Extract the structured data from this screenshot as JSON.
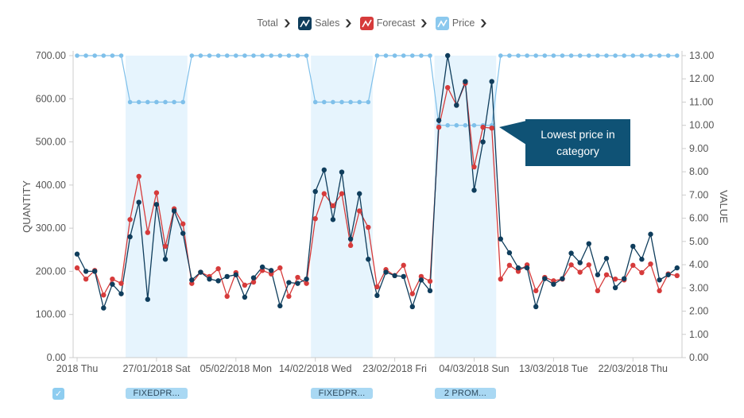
{
  "legend": {
    "items": [
      {
        "label": "Total",
        "has_icon": false
      },
      {
        "label": "Sales",
        "icon": "line-chart-icon",
        "color": "#0f3d5c"
      },
      {
        "label": "Forecast",
        "icon": "line-chart-icon",
        "color": "#d63b3b"
      },
      {
        "label": "Price",
        "icon": "line-chart-icon",
        "color": "#8cc9ee"
      }
    ],
    "dropdown_icon": "chevron-down-icon"
  },
  "callout": {
    "text_line1": "Lowest price in",
    "text_line2": "category"
  },
  "promotions": {
    "checkbox_checked": true,
    "tags": [
      {
        "label": "FIXEDPR...",
        "start_index": 6,
        "end_index": 12
      },
      {
        "label": "FIXEDPR...",
        "start_index": 27,
        "end_index": 33
      },
      {
        "label": "2 PROM...",
        "start_index": 41,
        "end_index": 47
      }
    ]
  },
  "colors": {
    "sales": "#0f3d5c",
    "forecast": "#d63b3b",
    "price": "#7fc0ea",
    "promo_band": "#e6f4fd",
    "axis": "#cccccc"
  },
  "chart_data": {
    "type": "line",
    "title": "",
    "xlabel": "",
    "ylabel": "QUANTITY",
    "y2label": "VALUE",
    "ylim": [
      0,
      700
    ],
    "y2lim": [
      0,
      13
    ],
    "yticks": [
      "0.00",
      "100.00",
      "200.00",
      "300.00",
      "400.00",
      "500.00",
      "600.00",
      "700.00"
    ],
    "y2ticks": [
      "0.00",
      "1.00",
      "2.00",
      "3.00",
      "4.00",
      "5.00",
      "6.00",
      "7.00",
      "8.00",
      "9.00",
      "10.00",
      "11.00",
      "12.00",
      "13.00"
    ],
    "x_start": "18/01/2018",
    "x_step_days": 1,
    "xticks": [
      {
        "index": 0,
        "label": "2018 Thu"
      },
      {
        "index": 9,
        "label": "27/01/2018 Sat"
      },
      {
        "index": 18,
        "label": "05/02/2018 Mon"
      },
      {
        "index": 27,
        "label": "14/02/2018 Wed"
      },
      {
        "index": 36,
        "label": "23/02/2018 Fri"
      },
      {
        "index": 45,
        "label": "04/03/2018 Sun"
      },
      {
        "index": 54,
        "label": "13/03/2018 Tue"
      },
      {
        "index": 63,
        "label": "22/03/2018 Thu"
      }
    ],
    "grid": false,
    "legend_position": "top",
    "series": [
      {
        "name": "Sales",
        "axis": "left",
        "values": [
          240,
          200,
          200,
          115,
          170,
          148,
          280,
          360,
          135,
          355,
          228,
          340,
          288,
          180,
          198,
          182,
          178,
          188,
          192,
          140,
          185,
          210,
          202,
          120,
          174,
          172,
          182,
          385,
          435,
          320,
          430,
          275,
          380,
          228,
          144,
          198,
          190,
          188,
          118,
          180,
          155,
          550,
          700,
          585,
          640,
          388,
          500,
          640,
          275,
          243,
          208,
          208,
          118,
          183,
          170,
          183,
          242,
          220,
          264,
          192,
          230,
          162,
          183,
          258,
          228,
          286,
          180,
          192,
          208
        ]
      },
      {
        "name": "Forecast",
        "axis": "left",
        "values": [
          208,
          182,
          202,
          145,
          182,
          172,
          320,
          420,
          290,
          382,
          258,
          345,
          310,
          172,
          198,
          188,
          206,
          142,
          197,
          168,
          175,
          202,
          194,
          208,
          142,
          186,
          172,
          322,
          380,
          352,
          380,
          260,
          340,
          302,
          164,
          204,
          190,
          214,
          148,
          188,
          177,
          534,
          626,
          585,
          636,
          442,
          534,
          532,
          182,
          214,
          200,
          215,
          155,
          186,
          178,
          182,
          215,
          198,
          215,
          155,
          192,
          182,
          180,
          214,
          197,
          217,
          155,
          194,
          190
        ]
      },
      {
        "name": "Price",
        "axis": "right",
        "values": [
          13,
          13,
          13,
          13,
          13,
          13,
          11,
          11,
          11,
          11,
          11,
          11,
          11,
          13,
          13,
          13,
          13,
          13,
          13,
          13,
          13,
          13,
          13,
          13,
          13,
          13,
          13,
          11,
          11,
          11,
          11,
          11,
          11,
          11,
          13,
          13,
          13,
          13,
          13,
          13,
          13,
          10,
          10,
          10,
          10,
          10,
          10,
          10,
          13,
          13,
          13,
          13,
          13,
          13,
          13,
          13,
          13,
          13,
          13,
          13,
          13,
          13,
          13,
          13,
          13,
          13,
          13,
          13,
          13
        ]
      }
    ]
  }
}
